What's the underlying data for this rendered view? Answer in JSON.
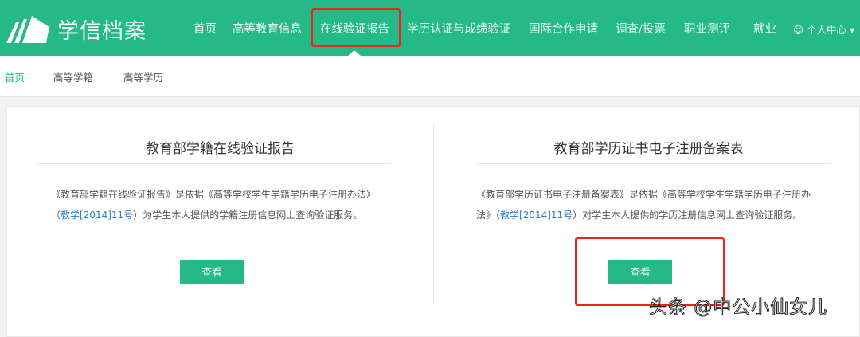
{
  "header": {
    "logo_text": "学信档案",
    "nav": [
      "首页",
      "高等教育信息",
      "在线验证报告",
      "学历认证与成绩验证",
      "国际合作申请",
      "调查/投票",
      "职业测评",
      "就业"
    ],
    "user_menu": "个人中心"
  },
  "subnav": [
    "首页",
    "高等学籍",
    "高等学历"
  ],
  "panels": [
    {
      "title": "教育部学籍在线验证报告",
      "desc_pre": "《教育部学籍在线验证报告》是依据《高等学校学生学籍学历电子注册办法》（",
      "desc_link": "教学[2014]11号",
      "desc_post": "）为学生本人提供的学籍注册信息网上查询验证服务。",
      "button": "查看"
    },
    {
      "title": "教育部学历证书电子注册备案表",
      "desc_pre": "《教育部学历证书电子注册备案表》是依据《高等学校学生学籍学历电子注册办法》（",
      "desc_link": "教学[2014]11号",
      "desc_post": "）对学生本人提供的学历注册信息网上查询验证服务。",
      "button": "查看"
    }
  ],
  "watermark": "头条 @中公小仙女儿",
  "colors": {
    "brand": "#25b988",
    "highlight": "#f0201a",
    "link": "#2a7fd4"
  }
}
